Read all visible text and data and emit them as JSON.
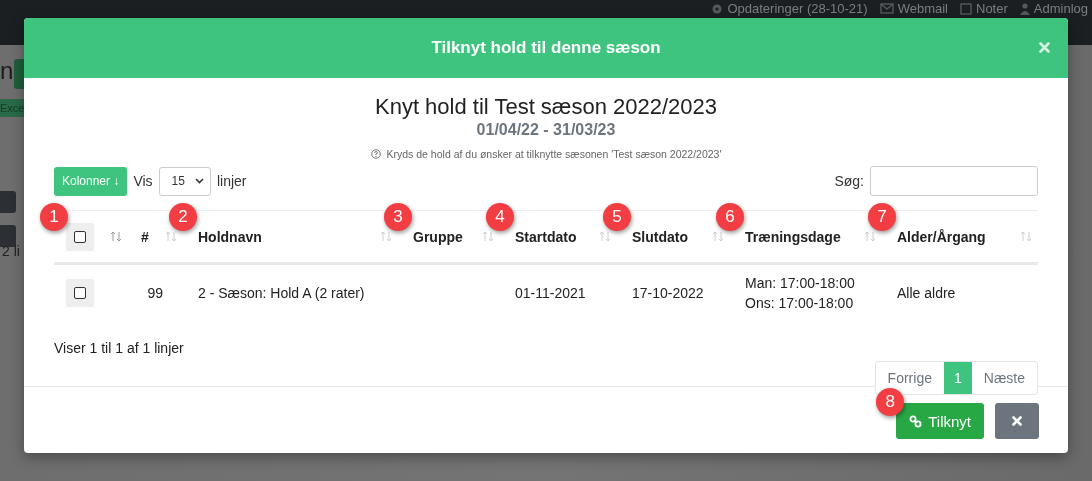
{
  "topbar": {
    "items": [
      {
        "kind": "gear",
        "label": "Opdateringer (28-10-21)"
      },
      {
        "kind": "mail",
        "label": "Webmail"
      },
      {
        "kind": "note",
        "label": "Noter"
      },
      {
        "kind": "user",
        "label": "Adminlog"
      }
    ]
  },
  "background_page": {
    "title_fragment": "n",
    "button_fragment": "Exce",
    "footer_fragment": "2 li"
  },
  "modal": {
    "title": "Tilknyt hold til denne sæson",
    "heading": "Knyt hold til Test sæson 2022/2023",
    "dates": "01/04/22 - 31/03/23",
    "hint": "Kryds de hold af du ønsker at tilknytte sæsonen 'Test sæson 2022/2023'",
    "columns_button": "Kolonner ↓",
    "show_label": "Vis",
    "page_size": "15",
    "rows_label": "linjer",
    "search_label": "Søg:",
    "table": {
      "select_all": {
        "checked": false,
        "badge": "1"
      },
      "columns": [
        {
          "label": "#"
        },
        {
          "label": "Holdnavn",
          "badge": "2"
        },
        {
          "label": "Gruppe",
          "badge": "3"
        },
        {
          "label": "Startdato",
          "badge": "4"
        },
        {
          "label": "Slutdato",
          "badge": "5"
        },
        {
          "label": "Træningsdage",
          "badge": "6"
        },
        {
          "label": "Alder/Årgang",
          "badge": "7"
        }
      ],
      "rows": [
        {
          "checked": false,
          "cells": [
            [
              "99"
            ],
            [
              "2 - Sæson: Hold A (2 rater)"
            ],
            [],
            [
              "01-11-2021"
            ],
            [
              "17-10-2022"
            ],
            [
              "Man: 17:00-18:00",
              "Ons: 17:00-18:00"
            ],
            [
              "Alle aldre"
            ]
          ]
        }
      ]
    },
    "info": "Viser 1 til 1 af 1 linjer",
    "pagination": [
      {
        "label": "Forrige",
        "selected": false
      },
      {
        "label": "1",
        "selected": true
      },
      {
        "label": "Næste",
        "selected": false
      }
    ],
    "link_button": {
      "label": "Tilknyt",
      "badge": "8"
    }
  }
}
